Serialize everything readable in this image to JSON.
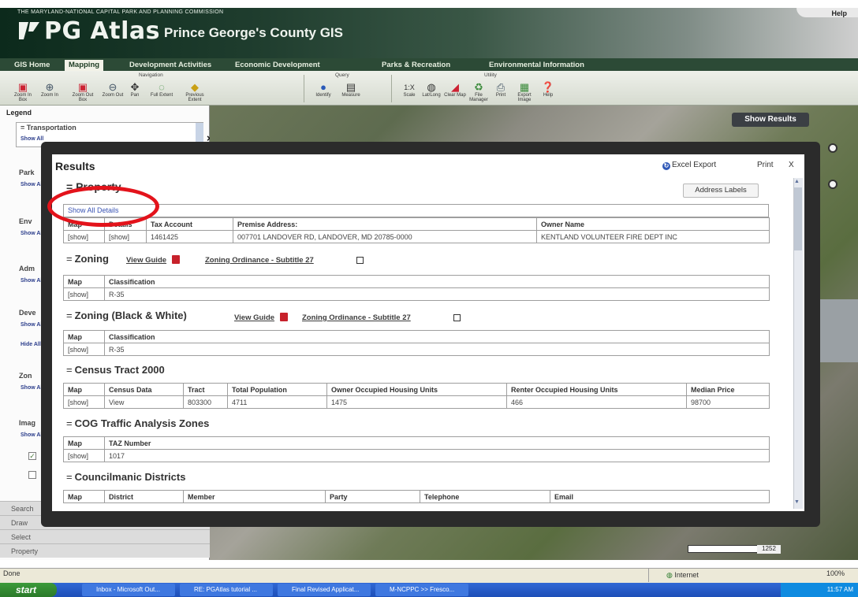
{
  "header": {
    "org": "THE MARYLAND-NATIONAL CAPITAL PARK AND PLANNING COMMISSION",
    "help": "Help",
    "logo": "PG Atlas",
    "subtitle": "Prince George's County GIS",
    "colors": {
      "banner_dark": "#0c2a1c",
      "nav_bar": "#2c4a36"
    }
  },
  "nav": {
    "tabs": [
      "GIS Home",
      "Mapping",
      "Development Activities",
      "Economic Development",
      "Parks & Recreation",
      "Environmental Information"
    ],
    "active": "Mapping"
  },
  "toolbar": {
    "groups": {
      "navigation": "Navigation",
      "query": "Query",
      "utility": "Utility"
    },
    "navigation": [
      "Zoom In Box",
      "Zoom In",
      "Zoom Out Box",
      "Zoom Out",
      "Pan",
      "Full Extent",
      "Previous Extent"
    ],
    "query": [
      "Identify",
      "Measure"
    ],
    "utility": [
      "Scale",
      "Lat/Long",
      "Clear Map",
      "File Manager",
      "Print",
      "Export Image",
      "Help"
    ]
  },
  "left_panel": {
    "legend": "Legend",
    "first_item": "Transportation",
    "items": [
      "Park",
      "Env",
      "Adm",
      "Deve",
      "Zon",
      "Imag"
    ],
    "show_label": "Show All",
    "hide_label": "Hide All",
    "bottom_tabs": [
      "Search",
      "Draw",
      "Select",
      "Property"
    ]
  },
  "map": {
    "show_results": "Show Results",
    "scale_value": "1252"
  },
  "results": {
    "title": "Results",
    "excel_export": "Excel Export",
    "print": "Print",
    "close": "X",
    "address_labels": "Address Labels",
    "property": {
      "heading": "Property",
      "show_all": "Show All Details",
      "columns": [
        "Map",
        "Details",
        "Tax Account",
        "Premise Address:",
        "Owner Name"
      ],
      "rows": [
        [
          "[show]",
          "[show]",
          "1461425",
          "007701 LANDOVER RD, LANDOVER, MD 20785-0000",
          "KENTLAND VOLUNTEER FIRE DEPT INC"
        ]
      ]
    },
    "zoning": {
      "heading": "Zoning",
      "view_guide": "View Guide",
      "ordinance": "Zoning Ordinance - Subtitle 27",
      "columns": [
        "Map",
        "Classification"
      ],
      "rows": [
        [
          "[show]",
          "R-35"
        ]
      ]
    },
    "zoning_bw": {
      "heading": "Zoning (Black & White)",
      "view_guide": "View Guide",
      "ordinance": "Zoning Ordinance - Subtitle 27",
      "columns": [
        "Map",
        "Classification"
      ],
      "rows": [
        [
          "[show]",
          "R-35"
        ]
      ]
    },
    "census": {
      "heading": "Census Tract 2000",
      "columns": [
        "Map",
        "Census Data",
        "Tract",
        "Total Population",
        "Owner Occupied Housing Units",
        "Renter Occupied Housing Units",
        "Median Price"
      ],
      "rows": [
        [
          "[show]",
          "View",
          "803300",
          "4711",
          "1475",
          "466",
          "98700"
        ]
      ]
    },
    "cog": {
      "heading": "COG Traffic Analysis Zones",
      "columns": [
        "Map",
        "TAZ Number"
      ],
      "rows": [
        [
          "[show]",
          "1017"
        ]
      ]
    },
    "council": {
      "heading": "Councilmanic Districts",
      "columns": [
        "Map",
        "District",
        "Member",
        "Party",
        "Telephone",
        "Email"
      ]
    }
  },
  "status_bar": {
    "left": "Done",
    "zone": "Internet",
    "zoom": "100%"
  },
  "taskbar": {
    "start": "start",
    "tasks": [
      "Inbox - Microsoft Out...",
      "RE: PGAtlas tutorial ...",
      "Final Revised Applicat...",
      "M-NCPPC >> Fresco..."
    ],
    "time": "11:57 AM"
  }
}
